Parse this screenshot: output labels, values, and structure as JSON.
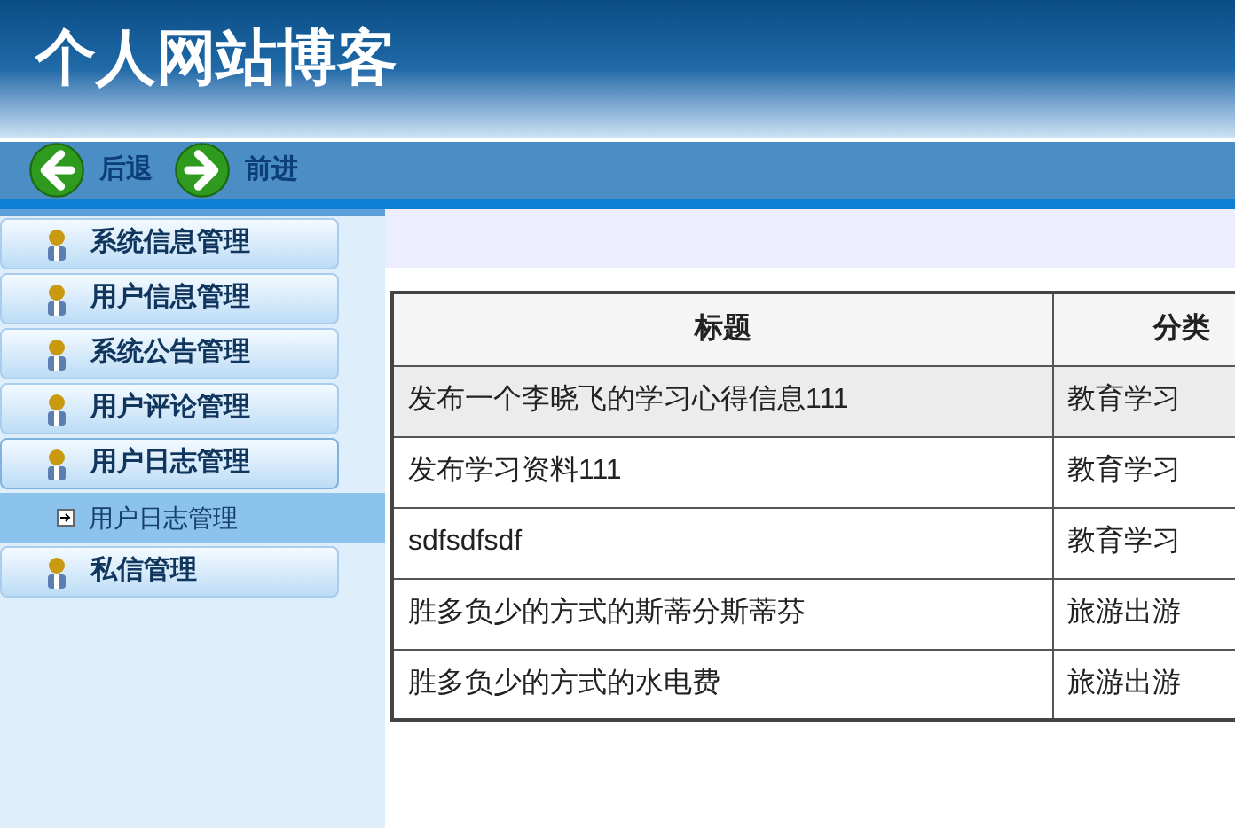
{
  "header": {
    "title": "个人网站博客"
  },
  "toolbar": [
    {
      "kind": "back",
      "label": "后退"
    },
    {
      "kind": "forward",
      "label": "前进"
    }
  ],
  "sidebar": {
    "items": [
      {
        "label": "系统信息管理",
        "expanded": false
      },
      {
        "label": "用户信息管理",
        "expanded": false
      },
      {
        "label": "系统公告管理",
        "expanded": false
      },
      {
        "label": "用户评论管理",
        "expanded": false
      },
      {
        "label": "用户日志管理",
        "expanded": true,
        "children": [
          {
            "label": "用户日志管理",
            "selected": true
          }
        ]
      },
      {
        "label": "私信管理",
        "expanded": false
      }
    ]
  },
  "table": {
    "columns": [
      "标题",
      "分类"
    ],
    "rows": [
      {
        "cells": [
          "发布一个李晓飞的学习心得信息111",
          "教育学习"
        ],
        "highlighted": true
      },
      {
        "cells": [
          "发布学习资料111",
          "教育学习"
        ],
        "highlighted": false
      },
      {
        "cells": [
          "sdfsdfsdf",
          "教育学习"
        ],
        "highlighted": false
      },
      {
        "cells": [
          "胜多负少的方式的斯蒂分斯蒂芬",
          "旅游出游"
        ],
        "highlighted": false
      },
      {
        "cells": [
          "胜多负少的方式的水电费",
          "旅游出游"
        ],
        "highlighted": false
      }
    ]
  }
}
